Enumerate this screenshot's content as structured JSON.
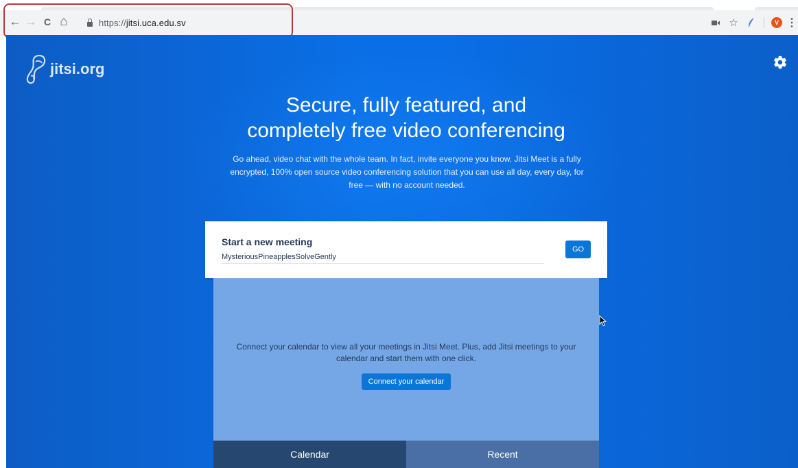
{
  "browser": {
    "back_icon": "←",
    "forward_icon": "→",
    "reload_icon": "C",
    "home_icon": "⌂",
    "url_scheme": "https://",
    "url_host": "jitsi.uca.edu.sv",
    "star_icon": "☆",
    "profile_initial": "V",
    "menu_icon": "⋮"
  },
  "header": {
    "logo_text": "jitsi.org"
  },
  "hero": {
    "headline_line1": "Secure, fully featured, and",
    "headline_line2": "completely free video conferencing",
    "subtext": "Go ahead, video chat with the whole team. In fact, invite everyone you know. Jitsi Meet is a fully encrypted, 100% open source video conferencing solution that you can use all day, every day, for free — with no account needed."
  },
  "meeting": {
    "title": "Start a new meeting",
    "room_name": "MysteriousPineapplesSolveGently",
    "go_label": "GO"
  },
  "calendar": {
    "message": "Connect your calendar to view all your meetings in Jitsi Meet. Plus, add Jitsi meetings to your calendar and start them with one click.",
    "connect_label": "Connect your calendar"
  },
  "tabs": [
    {
      "label": "Calendar",
      "active": true
    },
    {
      "label": "Recent",
      "active": false
    }
  ],
  "colors": {
    "accent": "#0b76d8",
    "page_blue": "#0a6ee6",
    "highlight": "#b43a3a"
  }
}
